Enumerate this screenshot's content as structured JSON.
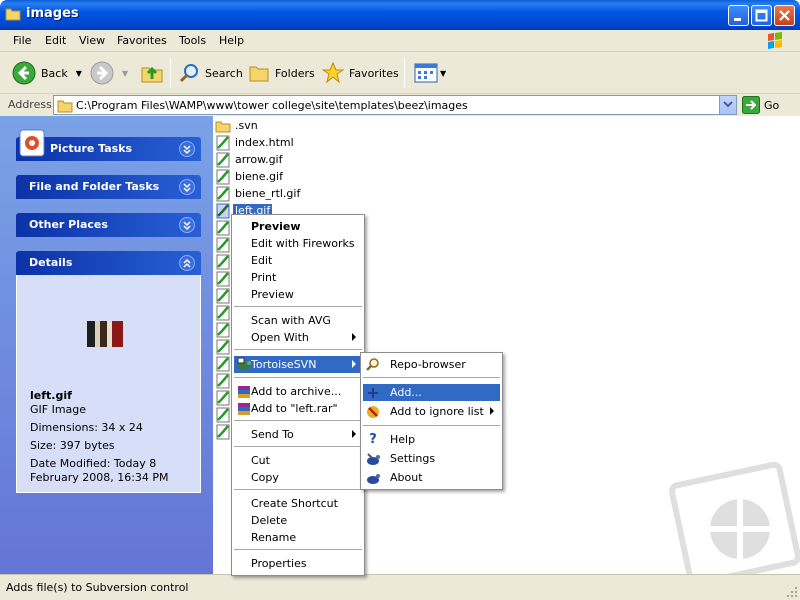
{
  "window": {
    "title": "images"
  },
  "menubar": [
    "File",
    "Edit",
    "View",
    "Favorites",
    "Tools",
    "Help"
  ],
  "toolbar": {
    "back": "Back",
    "search": "Search",
    "folders": "Folders",
    "favorites": "Favorites"
  },
  "address": {
    "label": "Address",
    "path": "C:\\Program Files\\WAMP\\www\\tower college\\site\\templates\\beez\\images",
    "go": "Go"
  },
  "taskpane": {
    "picture_tasks": "Picture Tasks",
    "file_folder_tasks": "File and Folder Tasks",
    "other_places": "Other Places",
    "details": "Details",
    "details_info": {
      "name": "left.gif",
      "type": "GIF Image",
      "dimensions": "Dimensions: 34 x 24",
      "size": "Size: 397 bytes",
      "date_line1": "Date Modified: Today 8",
      "date_line2": "February 2008, 16:34 PM"
    }
  },
  "files": [
    ".svn",
    "index.html",
    "arrow.gif",
    "biene.gif",
    "biene_rtl.gif",
    "left.gif"
  ],
  "context_menu": {
    "preview_bold": "Preview",
    "edit_fireworks": "Edit with Fireworks",
    "edit": "Edit",
    "print": "Print",
    "preview": "Preview",
    "scan_avg": "Scan with AVG",
    "open_with": "Open With",
    "tortoise": "TortoiseSVN",
    "add_archive": "Add to archive...",
    "add_rar": "Add to \"left.rar\"",
    "send_to": "Send To",
    "cut": "Cut",
    "copy": "Copy",
    "create_shortcut": "Create Shortcut",
    "delete": "Delete",
    "rename": "Rename",
    "properties": "Properties"
  },
  "svn_menu": {
    "repo_browser": "Repo-browser",
    "add": "Add...",
    "add_ignore": "Add to ignore list",
    "help": "Help",
    "settings": "Settings",
    "about": "About"
  },
  "status": {
    "text": "Adds file(s) to Subversion control"
  },
  "colors": {
    "xp_blue": "#0055e5",
    "selection": "#316ac5",
    "taskpane": "#7ba2e7"
  }
}
